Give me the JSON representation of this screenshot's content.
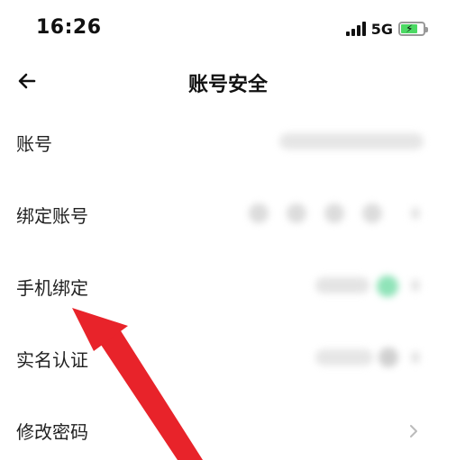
{
  "status_bar": {
    "time": "16:26",
    "network": "5G"
  },
  "header": {
    "title": "账号安全"
  },
  "rows": [
    {
      "label": "账号"
    },
    {
      "label": "绑定账号"
    },
    {
      "label": "手机绑定"
    },
    {
      "label": "实名认证"
    },
    {
      "label": "修改密码"
    }
  ],
  "colors": {
    "arrow": "#e8232a",
    "accent": "#22c37a"
  }
}
